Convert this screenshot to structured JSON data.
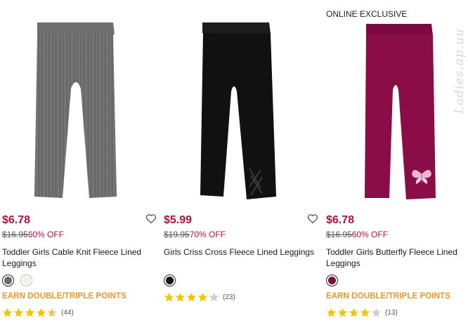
{
  "watermark": "Ladies.ap.uu",
  "colors": {
    "sale_red": "#b0123c",
    "points_orange": "#f0961e",
    "star_gold": "#f5c400",
    "star_empty": "#cfcfcf"
  },
  "products": [
    {
      "badge": "",
      "sale_price": "$6.78",
      "original_price": "$16.95",
      "discount": "60% OFF",
      "name": "Toddler Girls Cable Knit Fleece Lined Leggings",
      "swatch_colors": [
        "#6b6b6b",
        "#f1efe8"
      ],
      "points": "EARN DOUBLE/TRIPLE POINTS",
      "rating": 4.5,
      "review_count": "(44)",
      "icons": {
        "wishlist": "heart-outline-icon",
        "star": "star-icon"
      }
    },
    {
      "badge": "",
      "sale_price": "$5.99",
      "original_price": "$19.95",
      "discount": "70% OFF",
      "name": "Girls Criss Cross Fleece Lined Leggings",
      "swatch_colors": [
        "#111111"
      ],
      "points": "",
      "rating": 4,
      "review_count": "(23)",
      "icons": {
        "wishlist": "heart-outline-icon",
        "star": "star-icon"
      }
    },
    {
      "badge": "ONLINE EXCLUSIVE",
      "sale_price": "$6.78",
      "original_price": "$16.95",
      "discount": "60% OFF",
      "name": "Toddler Girls Butterfly Fleece Lined Leggings",
      "swatch_colors": [
        "#7a0c3e"
      ],
      "points": "EARN DOUBLE/TRIPLE POINTS",
      "rating": 4,
      "review_count": "(13)",
      "icons": {
        "wishlist": "heart-outline-icon",
        "star": "star-icon"
      }
    }
  ]
}
